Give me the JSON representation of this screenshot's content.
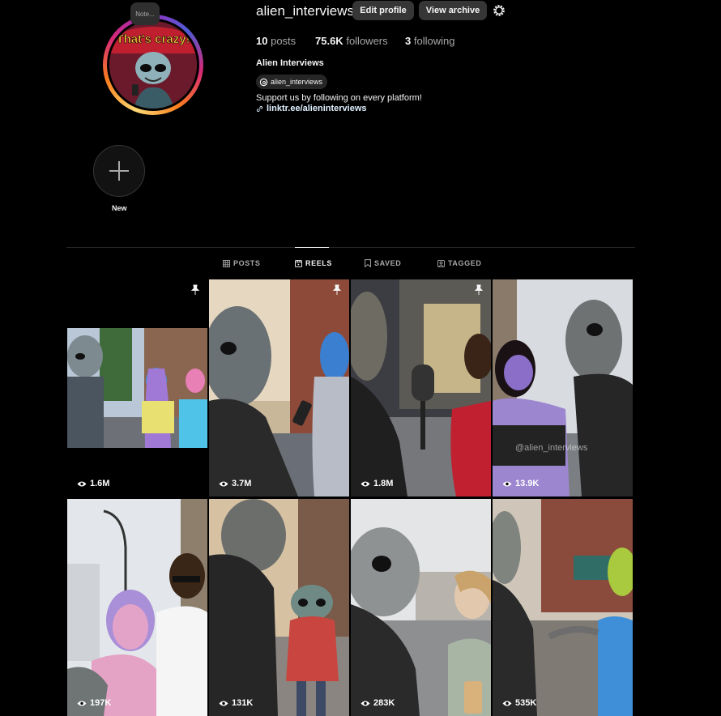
{
  "profile": {
    "note": "Note...",
    "avatar_text": "That's crazy!",
    "username": "alien_interviews",
    "edit_profile": "Edit profile",
    "view_archive": "View archive",
    "posts_count": "10",
    "posts_label": "posts",
    "followers_count": "75.6K",
    "followers_label": "followers",
    "following_count": "3",
    "following_label": "following",
    "full_name": "Alien Interviews",
    "threads_handle": "alien_interviews",
    "bio": "Support us by following on every platform!",
    "link": "linktr.ee/alieninterviews"
  },
  "highlights": {
    "new_label": "New"
  },
  "tabs": [
    {
      "label": "POSTS",
      "icon": "grid-icon"
    },
    {
      "label": "REELS",
      "icon": "reels-icon",
      "active": true
    },
    {
      "label": "SAVED",
      "icon": "bookmark-icon"
    },
    {
      "label": "TAGGED",
      "icon": "tagged-icon"
    }
  ],
  "reels": [
    {
      "views": "1.6M",
      "pinned": true
    },
    {
      "views": "3.7M",
      "pinned": true
    },
    {
      "views": "1.8M",
      "pinned": true
    },
    {
      "views": "13.9K",
      "pinned": false,
      "watermark": "@alien_interviews"
    },
    {
      "views": "197K",
      "pinned": false
    },
    {
      "views": "131K",
      "pinned": false
    },
    {
      "views": "283K",
      "pinned": false
    },
    {
      "views": "535K",
      "pinned": false
    }
  ]
}
